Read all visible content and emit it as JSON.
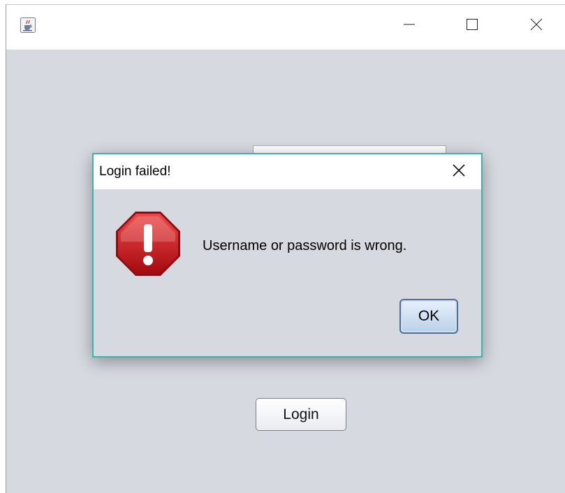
{
  "window": {
    "icon": "java-coffee-cup-icon",
    "controls": {
      "minimize_icon": "minimize-icon",
      "maximize_icon": "maximize-icon",
      "close_icon": "close-icon"
    }
  },
  "form": {
    "login_button": "Login"
  },
  "dialog": {
    "title": "Login failed!",
    "close_icon": "close-icon",
    "icon": "error-stop-icon",
    "message": "Username or password is wrong.",
    "ok_button": "OK",
    "accent_color": "#3fb3a8",
    "error_color": "#c0121a"
  }
}
